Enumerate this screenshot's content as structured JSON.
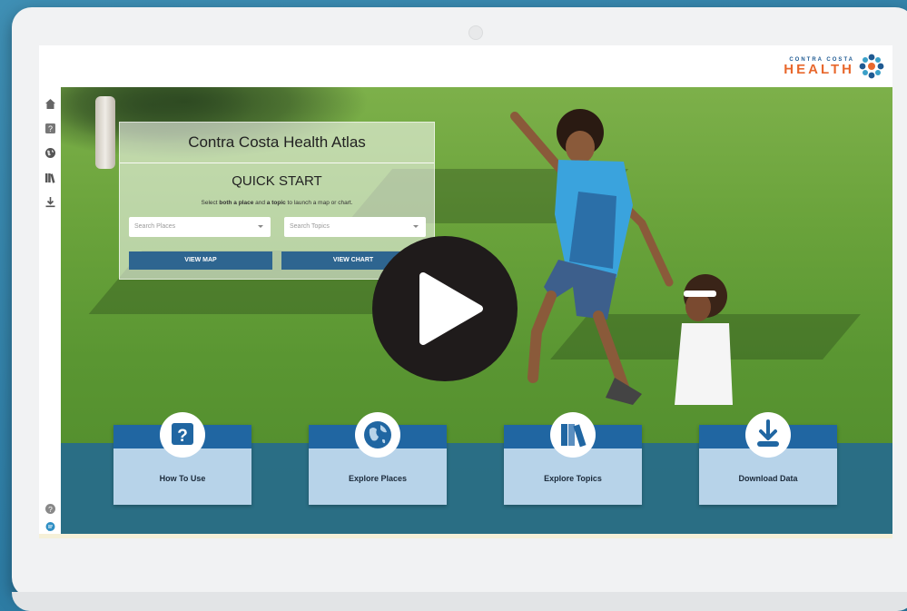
{
  "logo": {
    "line1": "CONTRA COSTA",
    "line2": "HEALTH"
  },
  "sidebar": {
    "items": [
      {
        "icon": "home-icon"
      },
      {
        "icon": "help-icon"
      },
      {
        "icon": "globe-icon"
      },
      {
        "icon": "books-icon"
      },
      {
        "icon": "download-icon"
      }
    ],
    "bottom_items": [
      {
        "icon": "help-circle-icon"
      },
      {
        "icon": "chat-icon"
      }
    ]
  },
  "quick_start": {
    "app_title": "Contra Costa Health Atlas",
    "heading": "QUICK START",
    "instruction_pre": "Select ",
    "instruction_b1": "both a place",
    "instruction_mid": " and ",
    "instruction_b2": "a topic",
    "instruction_post": " to launch a map or chart.",
    "places_placeholder": "Search Places",
    "topics_placeholder": "Search Topics",
    "view_map_label": "VIEW MAP",
    "view_chart_label": "VIEW CHART"
  },
  "cards": [
    {
      "label": "How To Use",
      "icon": "question-icon"
    },
    {
      "label": "Explore Places",
      "icon": "globe-icon"
    },
    {
      "label": "Explore Topics",
      "icon": "books-icon"
    },
    {
      "label": "Download Data",
      "icon": "download-icon"
    }
  ],
  "colors": {
    "brand_blue": "#2066a2",
    "card_bg": "#b7d3e9",
    "button_bg": "#2e6590",
    "logo_orange": "#e8682d",
    "play_bg": "#1f1b1b"
  }
}
